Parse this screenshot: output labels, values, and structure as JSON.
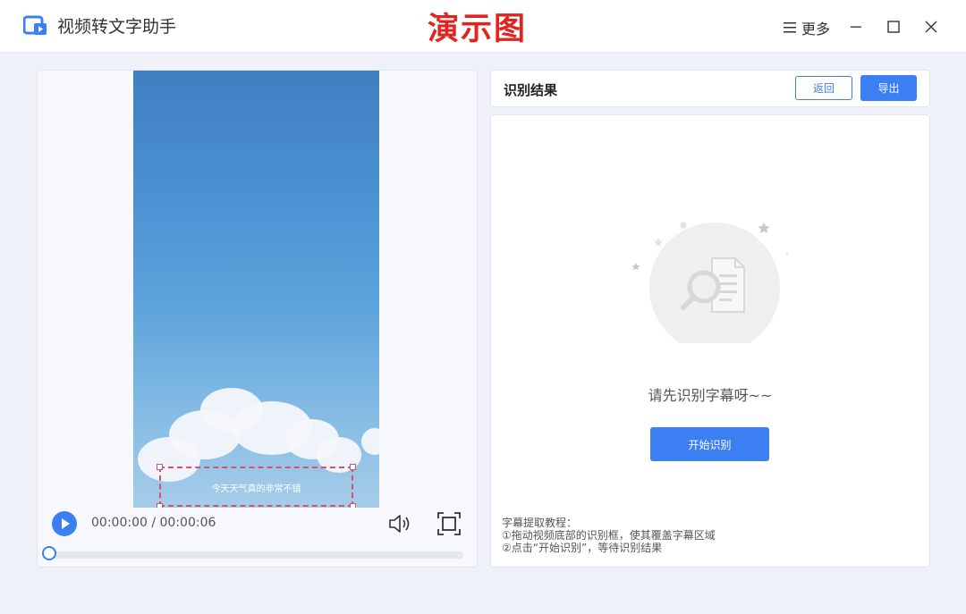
{
  "app": {
    "title": "视频转文字助手",
    "watermark": "演示图"
  },
  "titlebar": {
    "more_label": "更多"
  },
  "player": {
    "subtitle_text": "今天天气真的非常不错",
    "time_current": "00:00:00",
    "time_sep": " / ",
    "time_total": "00:00:06",
    "progress": 0
  },
  "result": {
    "title": "识别结果",
    "back_label": "返回",
    "export_label": "导出",
    "empty_text": "请先识别字幕呀~~",
    "start_label": "开始识别",
    "tutorial": {
      "heading": "字幕提取教程：",
      "step1": "①拖动视频底部的识别框，使其覆盖字幕区域",
      "step2": "②点击“开始识别”，等待识别结果"
    }
  },
  "colors": {
    "accent": "#3b7ff3",
    "watermark": "#e0241e",
    "subtitle_box": "#d9506b"
  }
}
